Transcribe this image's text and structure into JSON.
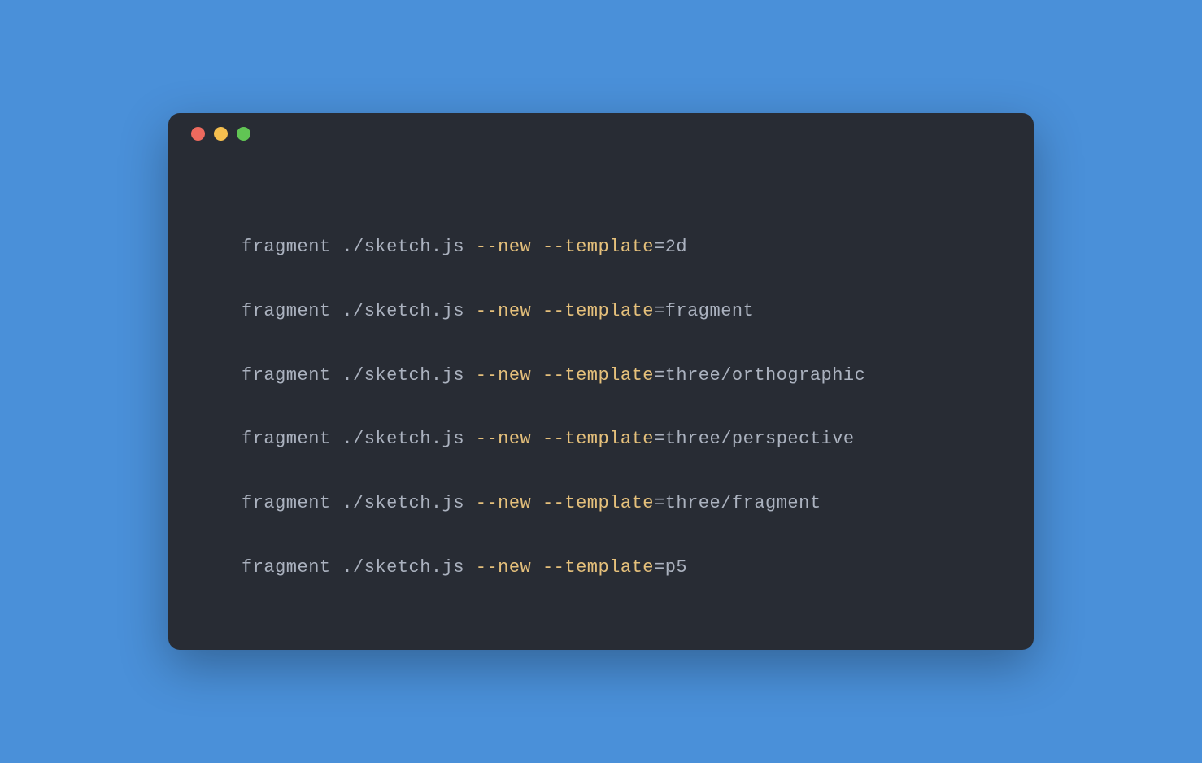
{
  "colors": {
    "background": "#4a90d9",
    "terminal_bg": "#282c34",
    "text": "#abb2bf",
    "flag": "#e5c07b",
    "traffic_close": "#ed6a5e",
    "traffic_minimize": "#f5bf4f",
    "traffic_maximize": "#61c554"
  },
  "commands": [
    {
      "prefix": "fragment ./sketch.js ",
      "flag1": "--new",
      "sep": " ",
      "flag2": "--template",
      "suffix": "=2d"
    },
    {
      "prefix": "fragment ./sketch.js ",
      "flag1": "--new",
      "sep": " ",
      "flag2": "--template",
      "suffix": "=fragment"
    },
    {
      "prefix": "fragment ./sketch.js ",
      "flag1": "--new",
      "sep": " ",
      "flag2": "--template",
      "suffix": "=three/orthographic"
    },
    {
      "prefix": "fragment ./sketch.js ",
      "flag1": "--new",
      "sep": " ",
      "flag2": "--template",
      "suffix": "=three/perspective"
    },
    {
      "prefix": "fragment ./sketch.js ",
      "flag1": "--new",
      "sep": " ",
      "flag2": "--template",
      "suffix": "=three/fragment"
    },
    {
      "prefix": "fragment ./sketch.js ",
      "flag1": "--new",
      "sep": " ",
      "flag2": "--template",
      "suffix": "=p5"
    }
  ]
}
